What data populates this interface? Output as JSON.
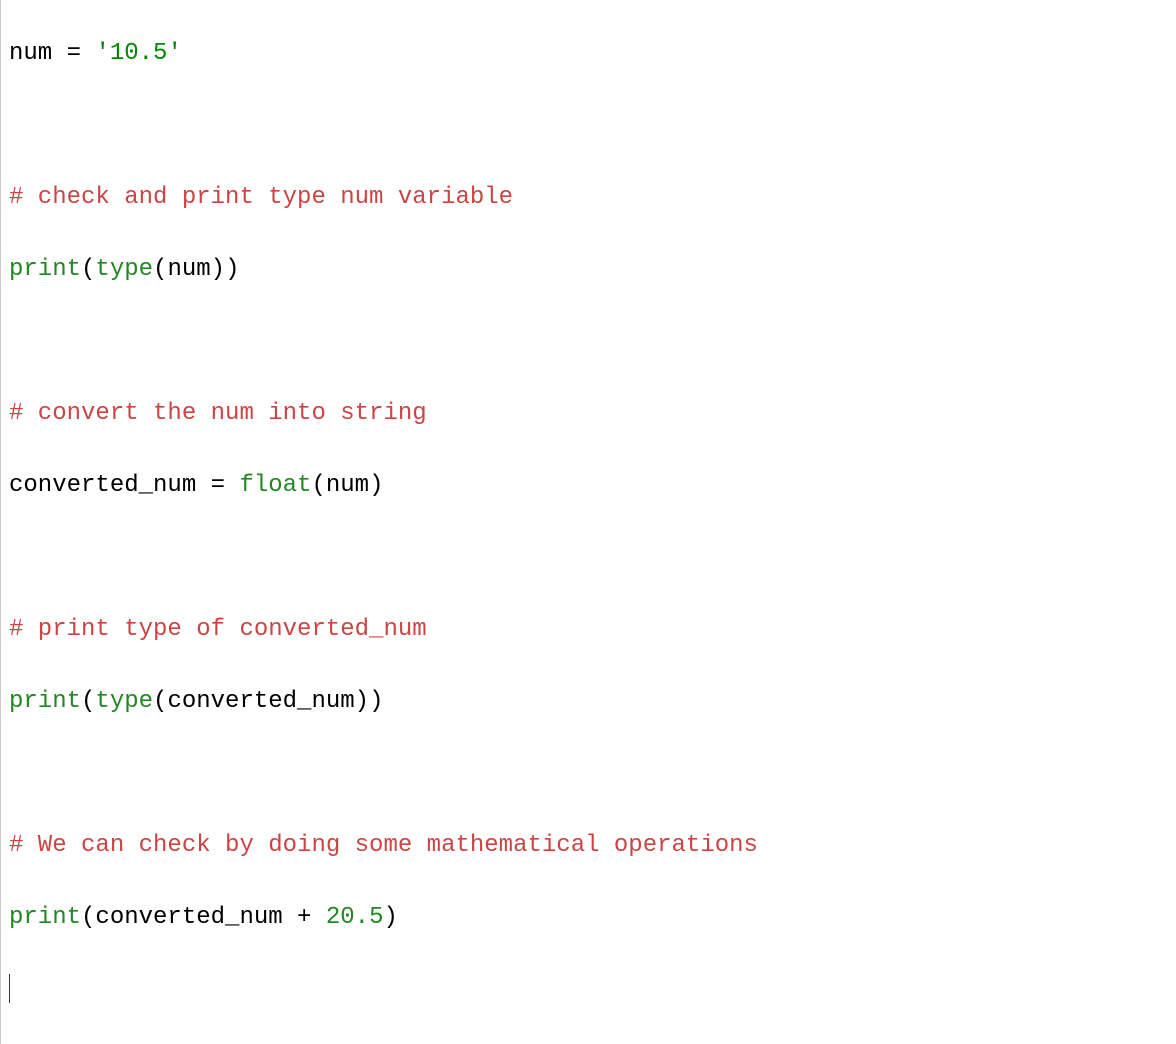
{
  "code": {
    "line1": {
      "var": "num",
      "op": " = ",
      "str": "'10.5'"
    },
    "line3": {
      "comment": "# check and print type num variable"
    },
    "line4": {
      "print": "print",
      "p1": "(",
      "type": "type",
      "p2": "(",
      "var": "num",
      "p3": ")",
      "p4": ")"
    },
    "line6": {
      "comment": "# convert the num into string"
    },
    "line7": {
      "var": "converted_num",
      "op": " = ",
      "float": "float",
      "p1": "(",
      "arg": "num",
      "p2": ")"
    },
    "line9": {
      "comment": "# print type of converted_num"
    },
    "line10": {
      "print": "print",
      "p1": "(",
      "type": "type",
      "p2": "(",
      "var": "converted_num",
      "p3": ")",
      "p4": ")"
    },
    "line12": {
      "comment": "# We can check by doing some mathematical operations"
    },
    "line13": {
      "print": "print",
      "p1": "(",
      "var": "converted_num",
      "op": " + ",
      "num": "20.5",
      "p2": ")"
    }
  }
}
